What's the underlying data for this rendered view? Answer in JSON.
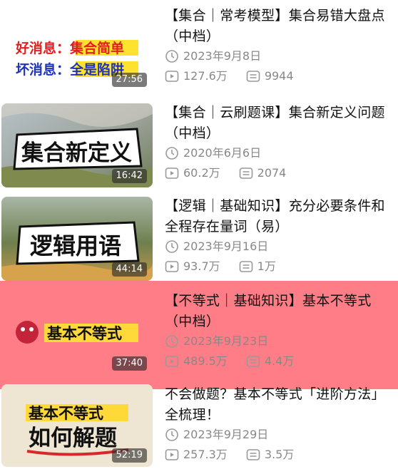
{
  "videos": [
    {
      "title": "【集合｜常考模型】集合易错大盘点（中档）",
      "date": "2023年9月8日",
      "views": "127.6万",
      "comments": "9944",
      "duration": "27:56",
      "thumb_lines": [
        "好消息：集合简单",
        "坏消息：全是陷阱"
      ]
    },
    {
      "title": "【集合｜云刷题课】集合新定义问题（中档）",
      "date": "2020年6月6日",
      "views": "60.2万",
      "comments": "2074",
      "duration": "16:42",
      "thumb_lines": [
        "集合新定义"
      ]
    },
    {
      "title": "【逻辑｜基础知识】充分必要条件和全程存在量词（易）",
      "date": "2023年9月16日",
      "views": "93.7万",
      "comments": "1万",
      "duration": "44:14",
      "thumb_lines": [
        "逻辑用语"
      ]
    },
    {
      "title": "【不等式｜基础知识】基本不等式（中档）",
      "date": "2023年9月23日",
      "views": "489.5万",
      "comments": "4.4万",
      "duration": "37:40",
      "thumb_lines": [
        "基本不等式"
      ]
    },
    {
      "title": "不会做题？基本不等式「进阶方法」全梳理！",
      "date": "2023年9月29日",
      "views": "257.3万",
      "comments": "3.5万",
      "duration": "52:19",
      "thumb_lines": [
        "基本不等式",
        "如何解题"
      ]
    }
  ],
  "colors": {
    "highlight": "#ff7d86",
    "meta": "#888888"
  }
}
